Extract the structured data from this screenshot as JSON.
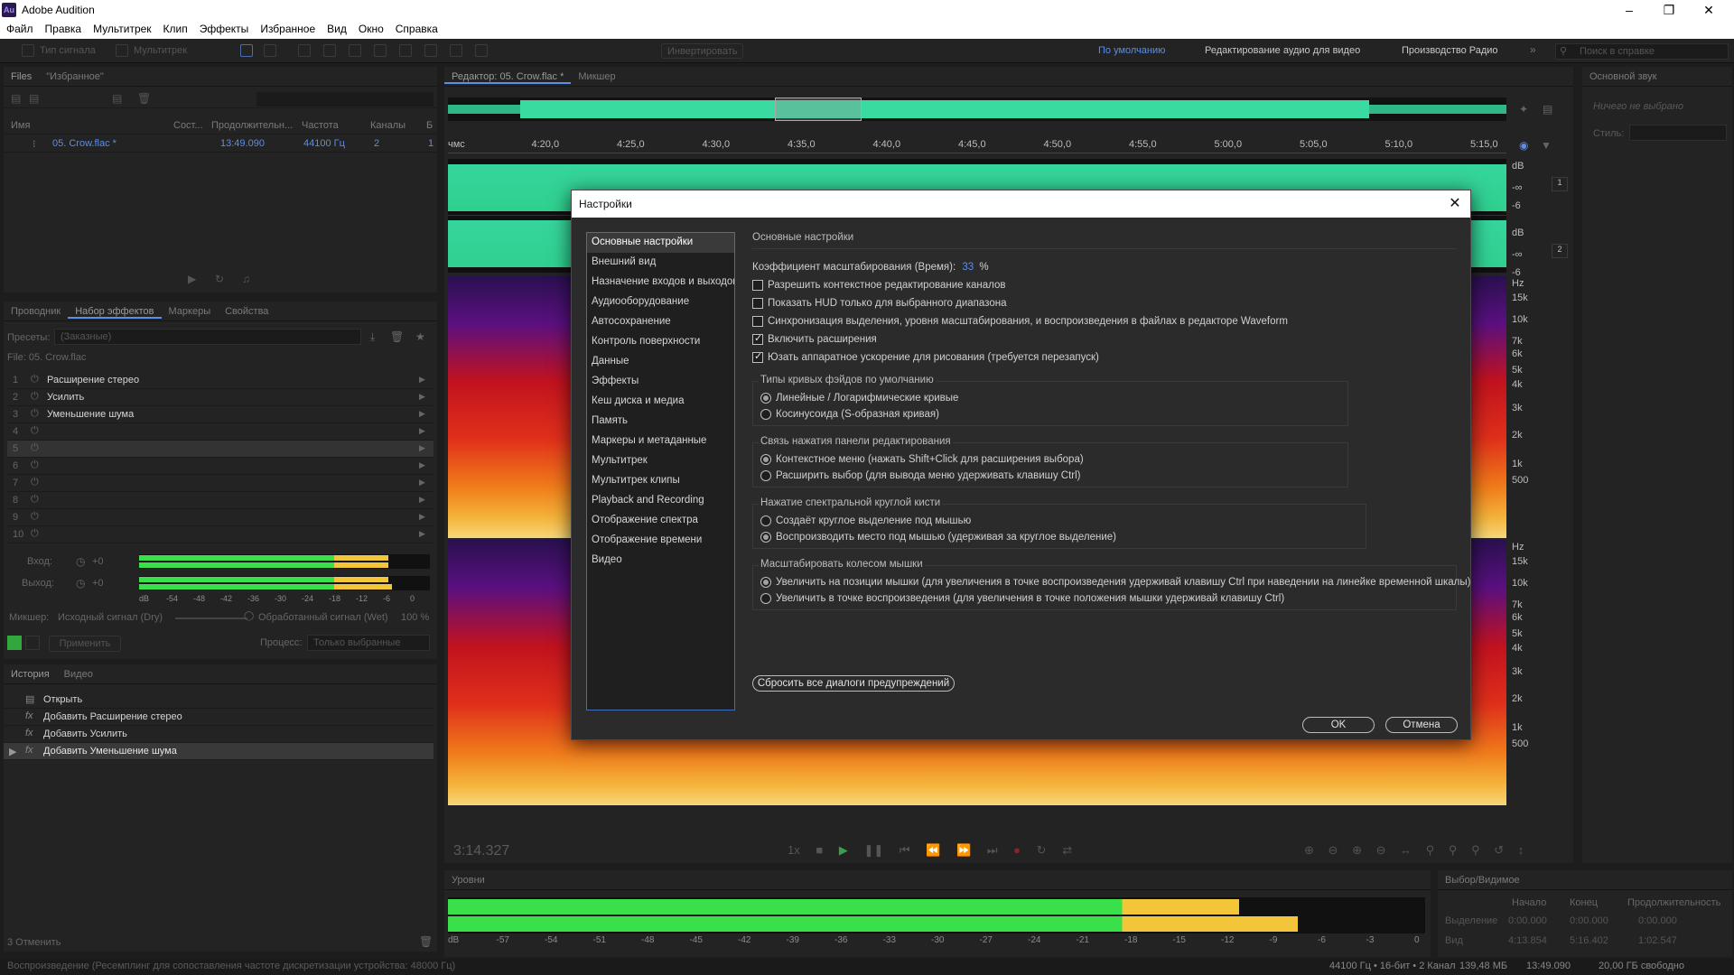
{
  "app": {
    "title": "Adobe Audition",
    "logo": "Au"
  },
  "menu": [
    "Файл",
    "Правка",
    "Мультитрек",
    "Клип",
    "Эффекты",
    "Избранное",
    "Вид",
    "Окно",
    "Справка"
  ],
  "toolbar": {
    "waveform": "Тип сигнала",
    "multitrack": "Мультитрек",
    "invert": "Инвертировать",
    "workspaces": [
      "По умолчанию",
      "Редактирование аудио для видео",
      "Производство Радио"
    ],
    "search_placeholder": "Поиск в справке"
  },
  "files_panel": {
    "tabs": [
      "Files",
      "\"Избранное\""
    ],
    "columns": [
      "Имя",
      "Сост...",
      "Продолжительн...",
      "Частота",
      "Каналы",
      "Б"
    ],
    "file": {
      "name": "05. Crow.flac *",
      "duration": "13:49.090",
      "rate": "44100 Гц",
      "channels": "2",
      "bits": "1"
    }
  },
  "effects_panel": {
    "tabs": [
      "Проводник",
      "Набор эффектов",
      "Маркеры",
      "Свойства"
    ],
    "presets_label": "Пресеты:",
    "preset_value": "(Заказные)",
    "file_label": "File: 05. Crow.flac",
    "rack": [
      {
        "n": "1",
        "name": "Расширение стерео"
      },
      {
        "n": "2",
        "name": "Усилить"
      },
      {
        "n": "3",
        "name": "Уменьшение шума"
      },
      {
        "n": "4",
        "name": ""
      },
      {
        "n": "5",
        "name": ""
      },
      {
        "n": "6",
        "name": ""
      },
      {
        "n": "7",
        "name": ""
      },
      {
        "n": "8",
        "name": ""
      },
      {
        "n": "9",
        "name": ""
      },
      {
        "n": "10",
        "name": ""
      }
    ],
    "input_label": "Вход:",
    "output_label": "Выход:",
    "gain": "+0",
    "db_scale": [
      "dB",
      "-54",
      "-48",
      "-42",
      "-36",
      "-30",
      "-24",
      "-18",
      "-12",
      "-6",
      "0"
    ],
    "mixer_label": "Микшер:",
    "dry": "Исходный сигнал (Dry)",
    "wet": "Обработанный сигнал (Wet)",
    "wet_pct": "100 %",
    "apply": "Применить",
    "process_label": "Процесс:",
    "process_value": "Только выбранные"
  },
  "history_panel": {
    "tabs": [
      "История",
      "Видео"
    ],
    "items": [
      "Открыть",
      "Добавить Расширение стерео",
      "Добавить Усилить",
      "Добавить Уменьшение шума"
    ],
    "undo": "3 Отменить"
  },
  "editor": {
    "tabs": [
      "Редактор: 05. Crow.flac *",
      "Микшер"
    ],
    "ruler": [
      "чмс",
      "4:20,0",
      "4:25,0",
      "4:30,0",
      "4:35,0",
      "4:40,0",
      "4:45,0",
      "4:50,0",
      "4:55,0",
      "5:00,0",
      "5:05,0",
      "5:10,0",
      "5:15,0"
    ],
    "db_axis": [
      "dB",
      "-∞",
      "-6"
    ],
    "hz_axis_top": [
      "Hz",
      "15k",
      "10k",
      "7k",
      "6k",
      "5k",
      "4k",
      "3k",
      "2k",
      "1k",
      "500"
    ],
    "hz_axis_bottom": [
      "Hz",
      "15k",
      "10k",
      "7k",
      "6k",
      "5k",
      "4k",
      "3k",
      "2k",
      "1k",
      "500"
    ],
    "time": "3:14.327",
    "speed": "1x",
    "channels": [
      "1",
      "2"
    ]
  },
  "levels": {
    "title": "Уровни",
    "scale": [
      "dB",
      "-57",
      "-54",
      "-51",
      "-48",
      "-45",
      "-42",
      "-39",
      "-36",
      "-33",
      "-30",
      "-27",
      "-24",
      "-21",
      "-18",
      "-15",
      "-12",
      "-9",
      "-6",
      "-3",
      "0"
    ],
    "left_level": 0.81,
    "right_level": 0.87
  },
  "selection": {
    "title": "Выбор/Видимое",
    "columns": [
      "Начало",
      "Конец",
      "Продолжительность"
    ],
    "rows": [
      {
        "label": "Выделение",
        "start": "0:00.000",
        "end": "0:00.000",
        "dur": "0:00.000"
      },
      {
        "label": "Вид",
        "start": "4:13.854",
        "end": "5:16.402",
        "dur": "1:02.547"
      }
    ]
  },
  "essential": {
    "title": "Основной звук",
    "none": "Ничего не выбрано",
    "style_label": "Стиль:"
  },
  "status": {
    "left": "Воспроизведение (Ресемплинг для сопоставления частоте дискретизации устройства: 48000 Гц)",
    "format": "44100 Гц • 16-бит • 2 Канал",
    "size": "139,48 МБ",
    "duration": "13:49.090",
    "free": "20,00 ГБ свободно"
  },
  "dialog": {
    "title": "Настройки",
    "nav": [
      "Основные настройки",
      "Внешний вид",
      "Назначение входов и выходов",
      "Аудиооборудование",
      "Автосохранение",
      "Контроль поверхности",
      "Данные",
      "Эффекты",
      "Кеш диска и медиа",
      "Память",
      "Маркеры и метаданные",
      "Мультитрек",
      "Мультитрек клипы",
      "Playback and Recording",
      "Отображение спектра",
      "Отображение времени",
      "Видео"
    ],
    "heading": "Основные настройки",
    "zoom_label": "Коэффициент масштабирования (Время):",
    "zoom_value": "33",
    "zoom_unit": "%",
    "checks": [
      {
        "label": "Разрешить контекстное редактирование каналов",
        "on": false
      },
      {
        "label": "Показать HUD только для выбранного диапазона",
        "on": false
      },
      {
        "label": "Синхронизация выделения, уровня масштабирования, и воспроизведения в файлах в редакторе Waveform",
        "on": false
      },
      {
        "label": "Включить расширения",
        "on": true
      },
      {
        "label": "Юзать аппаратное ускорение для рисования (требуется перезапуск)",
        "on": true
      }
    ],
    "groups": [
      {
        "title": "Типы кривых фэйдов по умолчанию",
        "options": [
          {
            "label": "Линейные / Логарифмические кривые",
            "on": true
          },
          {
            "label": "Косинусоида (S-образная кривая)",
            "on": false
          }
        ]
      },
      {
        "title": "Связь нажатия панели редактирования",
        "options": [
          {
            "label": "Контекстное меню (нажать Shift+Click для расширения выбора)",
            "on": true
          },
          {
            "label": "Расширить выбор (для вывода меню удерживать клавишу Ctrl)",
            "on": false
          }
        ]
      },
      {
        "title": "Нажатие спектральной круглой кисти",
        "options": [
          {
            "label": "Создаёт круглое выделение под мышью",
            "on": false
          },
          {
            "label": "Воспроизводить место под мышью (удерживая за круглое выделение)",
            "on": true
          }
        ]
      },
      {
        "title": "Масштабировать колесом мышки",
        "options": [
          {
            "label": "Увеличить на позиции мышки (для увеличения в точке воспроизведения удерживай клавишу Ctrl при наведении на линейке временной шкалы)",
            "on": true
          },
          {
            "label": "Увеличить в точке воспроизведения (для увеличения в точке положения мышки удерживай клавишу Ctrl)",
            "on": false
          }
        ]
      }
    ],
    "reset": "Сбросить все диалоги предупреждений",
    "ok": "OK",
    "cancel": "Отмена"
  }
}
